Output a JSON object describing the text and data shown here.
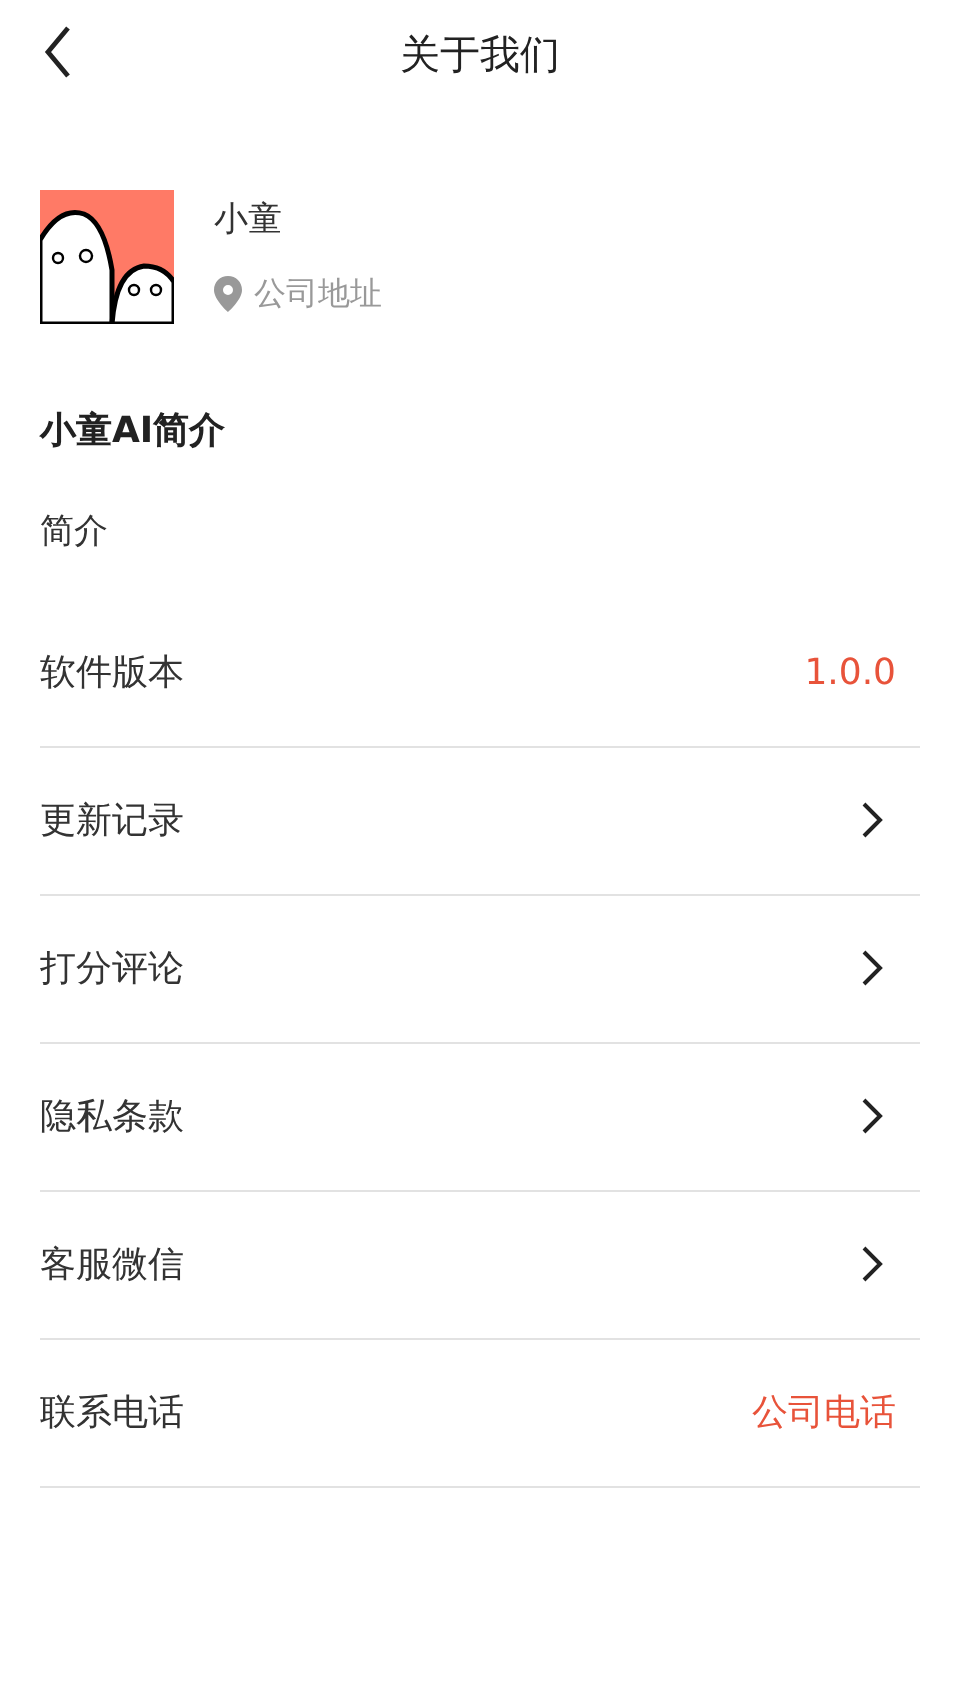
{
  "header": {
    "title": "关于我们"
  },
  "company": {
    "name": "小童",
    "address": "公司地址"
  },
  "intro": {
    "title": "小童AI简介",
    "text": "简介"
  },
  "rows": [
    {
      "kind": "value",
      "label": "软件版本",
      "value": "1.0.0"
    },
    {
      "kind": "link",
      "label": "更新记录"
    },
    {
      "kind": "link",
      "label": "打分评论"
    },
    {
      "kind": "link",
      "label": "隐私条款"
    },
    {
      "kind": "link",
      "label": "客服微信"
    },
    {
      "kind": "value",
      "label": "联系电话",
      "value": "公司电话"
    }
  ]
}
